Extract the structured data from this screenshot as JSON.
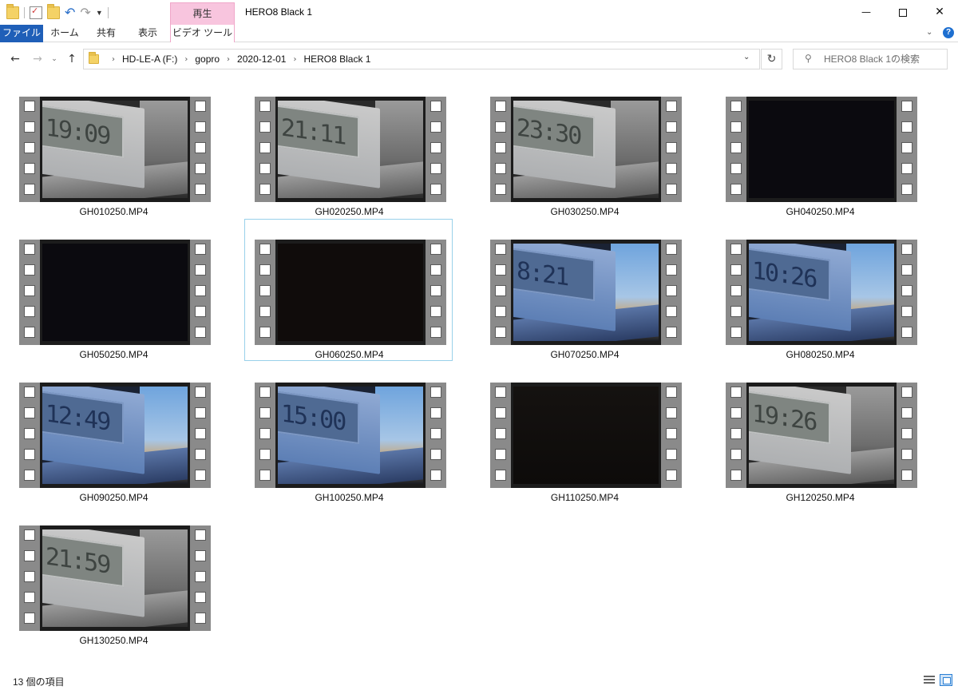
{
  "window": {
    "title": "HERO8 Black 1",
    "context_tab_header": "再生",
    "minimize": "—",
    "close": "✕"
  },
  "ribbon": {
    "tabs": [
      "ファイル",
      "ホーム",
      "共有",
      "表示",
      "ビデオ ツール"
    ]
  },
  "nav": {
    "breadcrumbs": [
      "HD-LE-A (F:)",
      "gopro",
      "2020-12-01",
      "HERO8 Black 1"
    ],
    "search_placeholder": "HERO8 Black 1の検索"
  },
  "files": [
    {
      "name": "GH010250.MP4",
      "thumb": "clock",
      "time": "19:09",
      "selected": false
    },
    {
      "name": "GH020250.MP4",
      "thumb": "clock",
      "time": "21:11",
      "selected": false
    },
    {
      "name": "GH030250.MP4",
      "thumb": "clock",
      "time": "23:30",
      "selected": false
    },
    {
      "name": "GH040250.MP4",
      "thumb": "dark",
      "time": "",
      "selected": false
    },
    {
      "name": "GH050250.MP4",
      "thumb": "dark",
      "time": "",
      "selected": false
    },
    {
      "name": "GH060250.MP4",
      "thumb": "darkbrown",
      "time": "",
      "selected": true
    },
    {
      "name": "GH070250.MP4",
      "thumb": "blue",
      "time": "8:21",
      "selected": false
    },
    {
      "name": "GH080250.MP4",
      "thumb": "blue",
      "time": "10:26",
      "selected": false
    },
    {
      "name": "GH090250.MP4",
      "thumb": "blue",
      "time": "12:49",
      "selected": false
    },
    {
      "name": "GH100250.MP4",
      "thumb": "blue",
      "time": "15:00",
      "selected": false
    },
    {
      "name": "GH110250.MP4",
      "thumb": "darkscene",
      "time": "",
      "selected": false
    },
    {
      "name": "GH120250.MP4",
      "thumb": "clock",
      "time": "19:26",
      "selected": false
    },
    {
      "name": "GH130250.MP4",
      "thumb": "clock",
      "time": "21:59",
      "selected": false
    }
  ],
  "status": {
    "item_count": "13 個の項目"
  },
  "colors": {
    "file_tab": "#1f5fb8",
    "context_tab": "#f8c5de",
    "selection_border": "#99d1ea"
  },
  "icons": [
    "folder-icon",
    "properties-icon",
    "new-folder-icon",
    "undo-icon",
    "redo-icon",
    "back-arrow-icon",
    "forward-arrow-icon",
    "up-arrow-icon",
    "refresh-icon",
    "search-icon",
    "help-icon",
    "details-view-icon",
    "large-icons-view-icon"
  ]
}
